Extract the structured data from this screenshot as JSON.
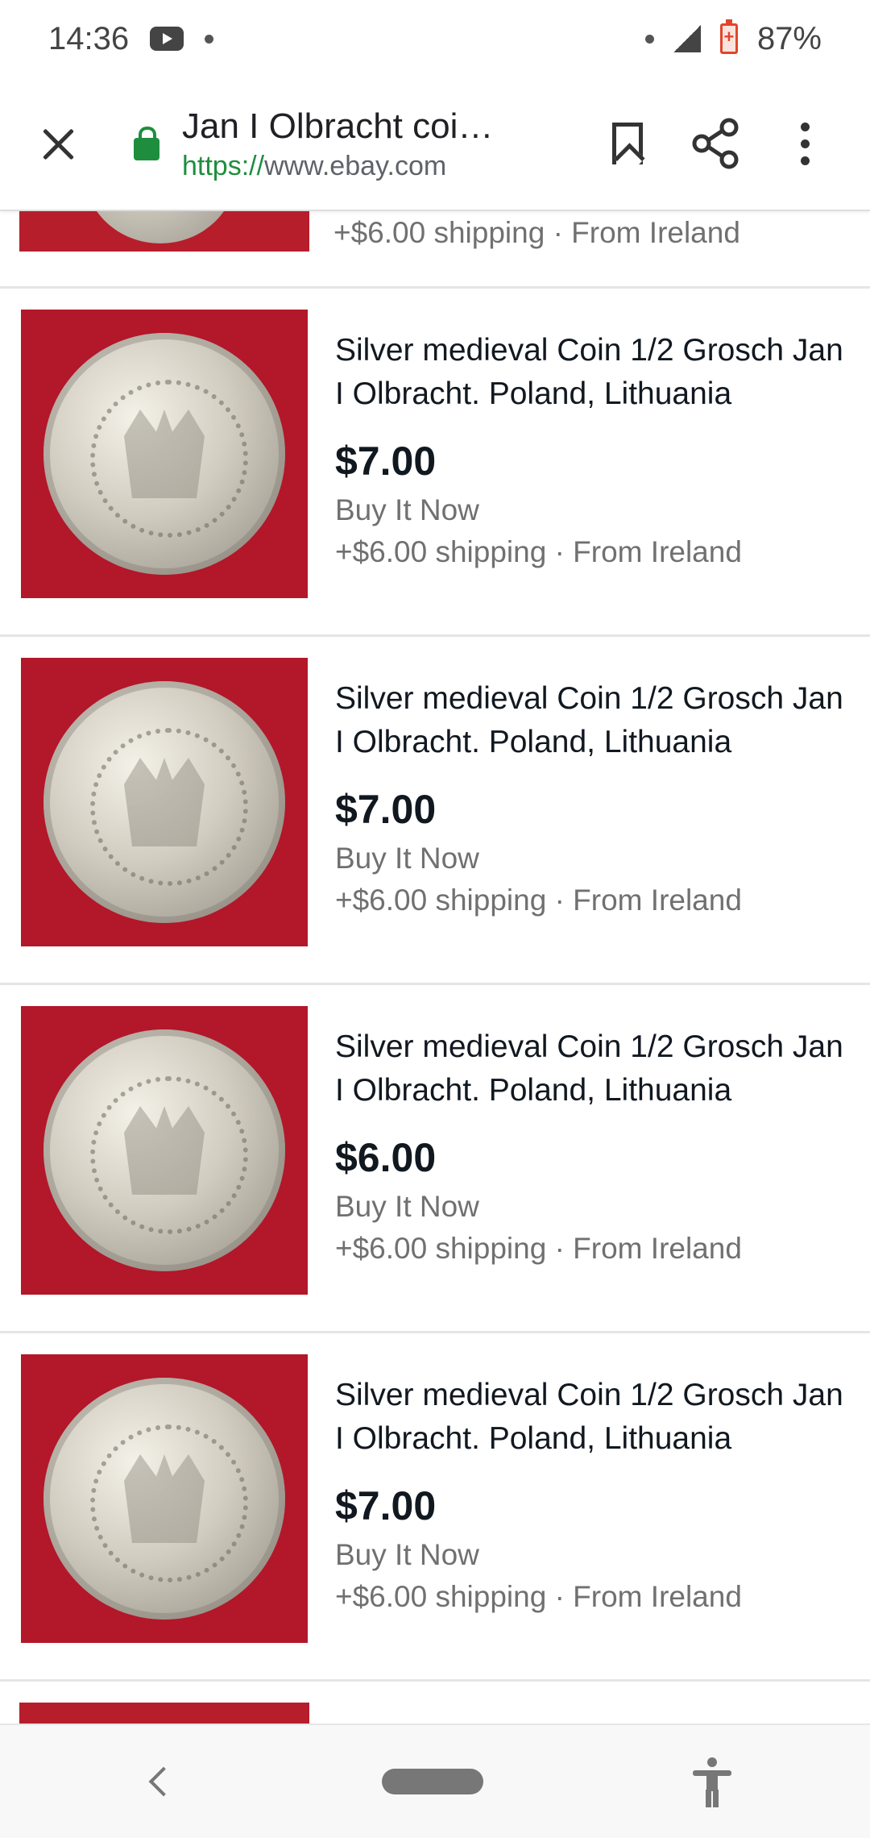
{
  "status_bar": {
    "time": "14:36",
    "battery": "87%",
    "icons": [
      "youtube-icon",
      "notification-dot-icon",
      "signal-icon",
      "battery-icon"
    ]
  },
  "toolbar": {
    "page_title": "Jan I Olbracht coi…",
    "url_scheme": "https://",
    "url_host": "www.ebay.com",
    "icons": [
      "close-icon",
      "lock-icon",
      "bookmark-icon",
      "share-icon",
      "more-menu-icon"
    ]
  },
  "top_partial": {
    "shipping": "+$6.00 shipping · From Ireland"
  },
  "listings": [
    {
      "title": "Silver medieval Coin 1/2 Grosch Jan I Olbracht. Poland, Lithuania",
      "price": "$7.00",
      "format": "Buy It Now",
      "shipping": "+$6.00 shipping · From Ireland"
    },
    {
      "title": "Silver medieval Coin 1/2 Grosch Jan I Olbracht. Poland, Lithuania",
      "price": "$7.00",
      "format": "Buy It Now",
      "shipping": "+$6.00 shipping · From Ireland"
    },
    {
      "title": "Silver medieval Coin 1/2 Grosch Jan I Olbracht. Poland, Lithuania",
      "price": "$6.00",
      "format": "Buy It Now",
      "shipping": "+$6.00 shipping · From Ireland"
    },
    {
      "title": "Silver medieval Coin 1/2 Grosch Jan I Olbracht. Poland, Lithuania",
      "price": "$7.00",
      "format": "Buy It Now",
      "shipping": "+$6.00 shipping · From Ireland"
    }
  ],
  "nav_bar": {
    "icons": [
      "back-icon",
      "home-pill-icon",
      "accessibility-icon"
    ]
  },
  "colors": {
    "secure_green": "#1e8e3e",
    "thumb_background": "#b3172a",
    "secondary_text": "#707070",
    "primary_text": "#111820"
  }
}
